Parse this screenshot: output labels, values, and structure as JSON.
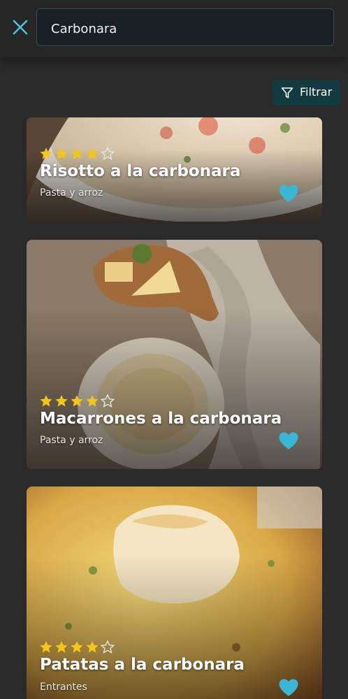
{
  "search": {
    "value": "Carbonara",
    "close_icon": "close-icon"
  },
  "filter": {
    "label": "Filtrar",
    "icon": "filter-icon"
  },
  "colors": {
    "accent": "#4cc3d9",
    "star": "#f4c51a",
    "heart": "#3bb6d4",
    "background": "#2a2a2a"
  },
  "recipes": [
    {
      "title": "Risotto a la carbonara",
      "category": "Pasta y arroz",
      "rating": 4,
      "max_rating": 5,
      "favorite": true
    },
    {
      "title": "Macarrones a la carbonara",
      "category": "Pasta y arroz",
      "rating": 4,
      "max_rating": 5,
      "favorite": true
    },
    {
      "title": "Patatas a la carbonara",
      "category": "Entrantes",
      "rating": 4,
      "max_rating": 5,
      "favorite": true
    }
  ]
}
